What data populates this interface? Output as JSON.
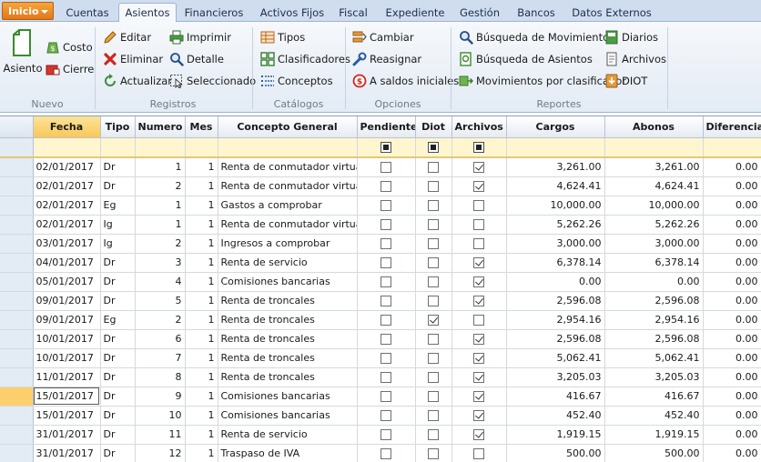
{
  "menu": {
    "inicio": "Inicio",
    "tabs": [
      "Cuentas",
      "Asientos",
      "Financieros",
      "Activos Fijos",
      "Fiscal",
      "Expediente",
      "Gestión",
      "Bancos",
      "Datos Externos"
    ],
    "active_tab": "Asientos"
  },
  "ribbon": {
    "nuevo": {
      "label": "Nuevo",
      "asiento": "Asiento",
      "costo": "Costo",
      "cierre": "Cierre"
    },
    "registros": {
      "label": "Registros",
      "editar": "Editar",
      "eliminar": "Eliminar",
      "actualizar": "Actualizar",
      "imprimir": "Imprimir",
      "detalle": "Detalle",
      "seleccionado": "Seleccionado"
    },
    "catalogos": {
      "label": "Catálogos",
      "tipos": "Tipos",
      "clasificadores": "Clasificadores",
      "conceptos": "Conceptos"
    },
    "opciones": {
      "label": "Opciones",
      "cambiar": "Cambiar",
      "reasignar": "Reasignar",
      "saldos": "A saldos iniciales"
    },
    "reportes": {
      "label": "Reportes",
      "busq_mov": "Búsqueda de Movimientos",
      "busq_asientos": "Búsqueda de Asientos",
      "mov_clasificador": "Movimientos por clasificador",
      "diarios": "Diarios",
      "archivos": "Archivos",
      "diot": "DIOT"
    }
  },
  "grid": {
    "columns": [
      "Fecha",
      "Tipo",
      "Numero",
      "Mes",
      "Concepto General",
      "Pendiente",
      "Diot",
      "Archivos",
      "Cargos",
      "Abonos",
      "Diferencia"
    ],
    "current_row": 12,
    "rows": [
      [
        "02/01/2017",
        "Dr",
        "1",
        "1",
        "Renta de conmutador virtual",
        false,
        false,
        true,
        "3,261.00",
        "3,261.00",
        "0.00"
      ],
      [
        "02/01/2017",
        "Dr",
        "2",
        "1",
        "Renta de conmutador virtual",
        false,
        false,
        true,
        "4,624.41",
        "4,624.41",
        "0.00"
      ],
      [
        "02/01/2017",
        "Eg",
        "1",
        "1",
        "Gastos a comprobar",
        false,
        false,
        false,
        "10,000.00",
        "10,000.00",
        "0.00"
      ],
      [
        "02/01/2017",
        "Ig",
        "1",
        "1",
        "Renta de conmutador virtual",
        false,
        false,
        false,
        "5,262.26",
        "5,262.26",
        "0.00"
      ],
      [
        "03/01/2017",
        "Ig",
        "2",
        "1",
        "Ingresos a comprobar",
        false,
        false,
        false,
        "3,000.00",
        "3,000.00",
        "0.00"
      ],
      [
        "04/01/2017",
        "Dr",
        "3",
        "1",
        "Renta de servicio",
        false,
        false,
        true,
        "6,378.14",
        "6,378.14",
        "0.00"
      ],
      [
        "05/01/2017",
        "Dr",
        "4",
        "1",
        "Comisiones bancarias",
        false,
        false,
        true,
        "0.00",
        "0.00",
        "0.00"
      ],
      [
        "09/01/2017",
        "Dr",
        "5",
        "1",
        "Renta de troncales",
        false,
        false,
        true,
        "2,596.08",
        "2,596.08",
        "0.00"
      ],
      [
        "09/01/2017",
        "Eg",
        "2",
        "1",
        "Renta de troncales",
        false,
        true,
        false,
        "2,954.16",
        "2,954.16",
        "0.00"
      ],
      [
        "10/01/2017",
        "Dr",
        "6",
        "1",
        "Renta de troncales",
        false,
        false,
        true,
        "2,596.08",
        "2,596.08",
        "0.00"
      ],
      [
        "10/01/2017",
        "Dr",
        "7",
        "1",
        "Renta de troncales",
        false,
        false,
        true,
        "5,062.41",
        "5,062.41",
        "0.00"
      ],
      [
        "11/01/2017",
        "Dr",
        "8",
        "1",
        "Renta de troncales",
        false,
        false,
        true,
        "3,205.03",
        "3,205.03",
        "0.00"
      ],
      [
        "15/01/2017",
        "Dr",
        "9",
        "1",
        "Comisiones bancarias",
        false,
        false,
        true,
        "416.67",
        "416.67",
        "0.00"
      ],
      [
        "15/01/2017",
        "Dr",
        "10",
        "1",
        "Comisiones bancarias",
        false,
        false,
        true,
        "452.40",
        "452.40",
        "0.00"
      ],
      [
        "31/01/2017",
        "Dr",
        "11",
        "1",
        "Renta de servicio",
        false,
        false,
        true,
        "1,919.15",
        "1,919.15",
        "0.00"
      ],
      [
        "31/01/2017",
        "Dr",
        "12",
        "1",
        "Traspaso de IVA",
        false,
        false,
        false,
        "500.00",
        "500.00",
        "0.00"
      ]
    ]
  },
  "colors": {
    "ribbon_bg": "#e3ebf5",
    "tab_bar": "#cfddef",
    "inicio_orange": "#e2781a",
    "filter_row": "#fff6cf",
    "selected_indicator": "#fbcf6b"
  },
  "icons": [
    "new-entry-icon",
    "cost-icon",
    "close-period-icon",
    "edit-pencil-icon",
    "delete-x-icon",
    "refresh-icon",
    "printer-icon",
    "magnifier-icon",
    "select-cursor-icon",
    "types-grid-icon",
    "classifiers-icon",
    "concepts-list-icon",
    "change-icon",
    "reassign-wrench-icon",
    "initial-balance-icon",
    "search-movements-icon",
    "search-entries-icon",
    "classifier-movements-icon",
    "journal-icon",
    "files-icon",
    "diot-icon"
  ]
}
